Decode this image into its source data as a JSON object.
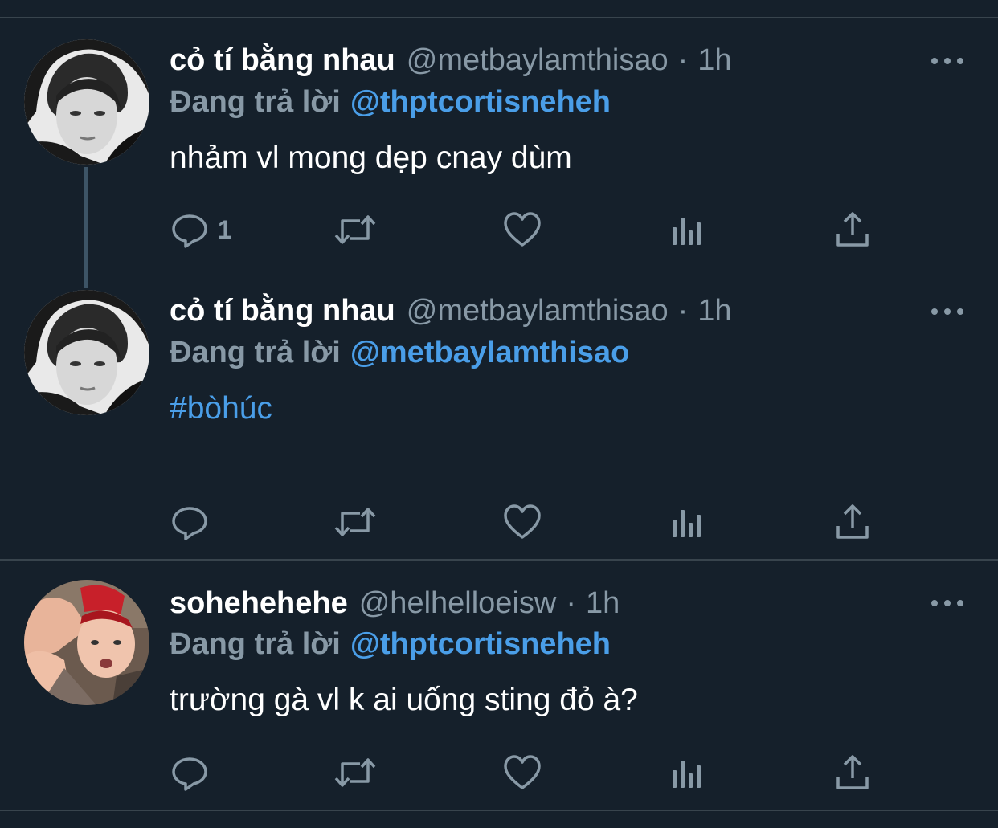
{
  "colors": {
    "background": "#15202b",
    "divider": "#38444d",
    "primary_text": "#ffffff",
    "secondary_text": "#8899a6",
    "link": "#4a9ee8",
    "thread_line": "#3d5466"
  },
  "tweets": [
    {
      "display_name": "cỏ tí bằng nhau",
      "handle": "@metbaylamthisao",
      "separator": "·",
      "time": "1h",
      "reply_prefix": "Đang trả lời",
      "reply_target": "@thptcortisneheh",
      "text": "nhảm vl mong dẹp cnay dùm",
      "reply_count": "1",
      "avatar_icon": "avatar-photo",
      "more_icon": "more-icon"
    },
    {
      "display_name": "cỏ tí bằng nhau",
      "handle": "@metbaylamthisao",
      "separator": "·",
      "time": "1h",
      "reply_prefix": "Đang trả lời",
      "reply_target": "@metbaylamthisao",
      "text": "#bòhúc",
      "reply_count": "",
      "avatar_icon": "avatar-photo",
      "more_icon": "more-icon"
    },
    {
      "display_name": "sohehehehe",
      "handle": "@helhelloeisw",
      "separator": "·",
      "time": "1h",
      "reply_prefix": "Đang trả lời",
      "reply_target": "@thptcortisneheh",
      "text": "trường gà vl k ai uống sting đỏ à?",
      "reply_count": "",
      "avatar_icon": "avatar-photo",
      "more_icon": "more-icon"
    }
  ],
  "action_icons": [
    "reply-icon",
    "retweet-icon",
    "like-icon",
    "analytics-icon",
    "share-icon"
  ]
}
